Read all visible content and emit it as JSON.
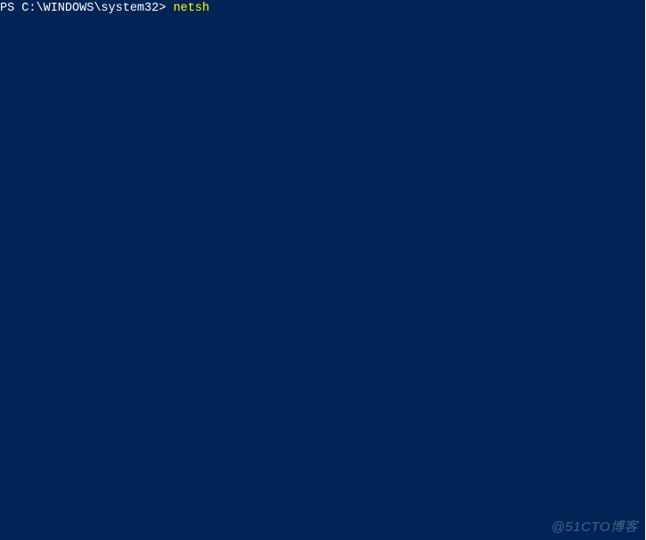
{
  "terminal": {
    "prompt": "PS C:\\WINDOWS\\system32> ",
    "command": "netsh"
  },
  "watermark": "@51CTO博客"
}
